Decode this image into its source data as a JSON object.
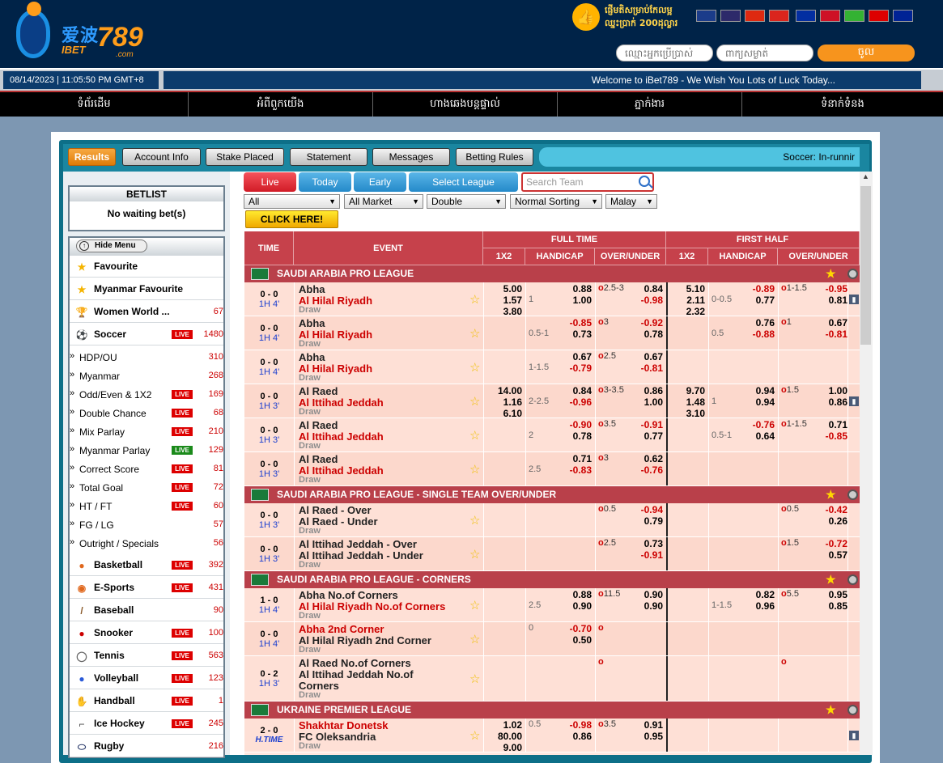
{
  "header": {
    "logo_cn": "爱波",
    "logo_num": "789",
    "logo_sub": "IBET",
    "logo_dotcom": ".com",
    "promo_line1": "ផ្ញើមតិសម្រាប់កែលម្អ",
    "promo_line2": "ឈ្នះប្រាក់ 200ដុល្លារ",
    "username_placeholder": "ឈ្មោះអ្នកប្រើប្រាស់",
    "password_placeholder": "ពាក្យសម្ងាត់",
    "login_label": "ចូល",
    "flags": [
      {
        "name": "english-flag-icon",
        "color": "#1b3c8a"
      },
      {
        "name": "thai-flag-icon",
        "color": "#2d2a6a"
      },
      {
        "name": "china-flag-icon",
        "color": "#de2910"
      },
      {
        "name": "vietnam-flag-icon",
        "color": "#da251d"
      },
      {
        "name": "cambodia-flag-icon",
        "color": "#032ea1"
      },
      {
        "name": "indonesia-flag-icon",
        "color": "#ce1126"
      },
      {
        "name": "myanmar-flag-icon",
        "color": "#34b233"
      },
      {
        "name": "germany-flag-icon",
        "color": "#dd0000"
      },
      {
        "name": "france-flag-icon",
        "color": "#002395"
      }
    ]
  },
  "status": {
    "datetime": "08/14/2023  |  11:05:50 PM GMT+8",
    "marquee": "Welcome to iBet789 - We Wish You Lots of Luck Today..."
  },
  "nav": [
    "ទំព័រដើម",
    "អំពីពួកយើង",
    "ហាងឆេងបន្តផ្ទាល់",
    "ភ្នាក់ងារ",
    "ទំនាក់ទំនង"
  ],
  "tabs": {
    "results": "Results",
    "account": "Account Info",
    "stake": "Stake Placed",
    "statement": "Statement",
    "messages": "Messages",
    "rules": "Betting Rules",
    "ticker": "Soccer: In-runnir"
  },
  "betlist": {
    "title": "BETLIST",
    "body": "No waiting bet(s)"
  },
  "menu": {
    "hide": "Hide Menu",
    "live_badge": "LIVE",
    "items": [
      {
        "label": "Favourite",
        "count": "",
        "icon": "star-icon",
        "live": false
      },
      {
        "label": "Myanmar Favourite",
        "count": "",
        "icon": "star-icon",
        "live": false
      },
      {
        "label": "Women World ...",
        "count": "67",
        "icon": "trophy-icon",
        "live": false
      },
      {
        "label": "Soccer",
        "count": "1480",
        "icon": "soccer-ball-icon",
        "live": true
      }
    ],
    "soccer_sub": [
      {
        "label": "HDP/OU",
        "count": "310",
        "live": false
      },
      {
        "label": "Myanmar",
        "count": "268",
        "live": false
      },
      {
        "label": "Odd/Even & 1X2",
        "count": "169",
        "live": true
      },
      {
        "label": "Double Chance",
        "count": "68",
        "live": true
      },
      {
        "label": "Mix Parlay",
        "count": "210",
        "live": true
      },
      {
        "label": "Myanmar Parlay",
        "count": "129",
        "live": true,
        "green": true
      },
      {
        "label": "Correct Score",
        "count": "81",
        "live": true
      },
      {
        "label": "Total Goal",
        "count": "72",
        "live": true
      },
      {
        "label": "HT / FT",
        "count": "60",
        "live": true
      },
      {
        "label": "FG / LG",
        "count": "57",
        "live": false
      },
      {
        "label": "Outright / Specials",
        "count": "56",
        "live": false
      }
    ],
    "sports": [
      {
        "label": "Basketball",
        "count": "392",
        "icon": "basketball-icon",
        "live": true
      },
      {
        "label": "E-Sports",
        "count": "431",
        "icon": "gamepad-icon",
        "live": true
      },
      {
        "label": "Baseball",
        "count": "90",
        "icon": "baseball-bat-icon",
        "live": false
      },
      {
        "label": "Snooker",
        "count": "100",
        "icon": "snooker-icon",
        "live": true
      },
      {
        "label": "Tennis",
        "count": "563",
        "icon": "tennis-racket-icon",
        "live": true
      },
      {
        "label": "Volleyball",
        "count": "123",
        "icon": "volleyball-icon",
        "live": true
      },
      {
        "label": "Handball",
        "count": "1",
        "icon": "handball-icon",
        "live": true
      },
      {
        "label": "Ice Hockey",
        "count": "245",
        "icon": "ice-hockey-icon",
        "live": true
      },
      {
        "label": "Rugby",
        "count": "216",
        "icon": "rugby-ball-icon",
        "live": false
      }
    ]
  },
  "filters": {
    "live": "Live",
    "today": "Today",
    "early": "Early",
    "select_league": "Select League",
    "search_placeholder": "Search Team",
    "dd_all": "All",
    "dd_market": "All Market",
    "dd_double": "Double",
    "dd_sorting": "Normal Sorting",
    "dd_malay": "Malay",
    "click_here": "CLICK HERE!"
  },
  "table_head": {
    "time": "TIME",
    "event": "EVENT",
    "full_time": "FULL TIME",
    "first_half": "FIRST HALF",
    "x12": "1X2",
    "handicap": "HANDICAP",
    "ou": "OVER/UNDER"
  },
  "leagues": [
    {
      "name": "SAUDI ARABIA PRO LEAGUE",
      "matches": [
        {
          "score": "0 - 0",
          "time": "1H 4'",
          "home": "Abha",
          "away": "Al Hilal Riyadh",
          "draw": "Draw",
          "red": "away",
          "x12": [
            "5.00",
            "1.57",
            "3.80"
          ],
          "hdp": "1",
          "hdp_row": 2,
          "hdp_odds": [
            "0.88",
            "1.00"
          ],
          "ou": "2.5-3",
          "ou_odds": [
            "0.84",
            "-0.98"
          ],
          "h_x12": [
            "5.10",
            "2.11",
            "2.32"
          ],
          "h_hdp": "0-0.5",
          "h_hdp_row": 2,
          "h_hdp_odds": [
            "-0.89",
            "0.77"
          ],
          "h_ou": "1-1.5",
          "h_ou_odds": [
            "-0.95",
            "0.81"
          ],
          "chart": true
        },
        {
          "score": "0 - 0",
          "time": "1H 4'",
          "home": "Abha",
          "away": "Al Hilal Riyadh",
          "draw": "Draw",
          "red": "away",
          "x12": [],
          "hdp": "0.5-1",
          "hdp_row": 2,
          "hdp_odds": [
            "-0.85",
            "0.73"
          ],
          "ou": "3",
          "ou_odds": [
            "-0.92",
            "0.78"
          ],
          "h_x12": [],
          "h_hdp": "0.5",
          "h_hdp_row": 2,
          "h_hdp_odds": [
            "0.76",
            "-0.88"
          ],
          "h_ou": "1",
          "h_ou_odds": [
            "0.67",
            "-0.81"
          ],
          "chart": false
        },
        {
          "score": "0 - 0",
          "time": "1H 4'",
          "home": "Abha",
          "away": "Al Hilal Riyadh",
          "draw": "Draw",
          "red": "away",
          "x12": [],
          "hdp": "1-1.5",
          "hdp_row": 2,
          "hdp_odds": [
            "0.67",
            "-0.79"
          ],
          "ou": "2.5",
          "ou_odds": [
            "0.67",
            "-0.81"
          ],
          "h_x12": [],
          "h_hdp": "",
          "h_hdp_row": 2,
          "h_hdp_odds": [
            "",
            ""
          ],
          "h_ou": "",
          "h_ou_odds": [
            "",
            ""
          ],
          "chart": false
        },
        {
          "score": "0 - 0",
          "time": "1H 3'",
          "home": "Al Raed",
          "away": "Al Ittihad Jeddah",
          "draw": "Draw",
          "red": "away",
          "x12": [
            "14.00",
            "1.16",
            "6.10"
          ],
          "hdp": "2-2.5",
          "hdp_row": 2,
          "hdp_odds": [
            "0.84",
            "-0.96"
          ],
          "ou": "3-3.5",
          "ou_odds": [
            "0.86",
            "1.00"
          ],
          "h_x12": [
            "9.70",
            "1.48",
            "3.10"
          ],
          "h_hdp": "1",
          "h_hdp_row": 2,
          "h_hdp_odds": [
            "0.94",
            "0.94"
          ],
          "h_ou": "1.5",
          "h_ou_odds": [
            "1.00",
            "0.86"
          ],
          "chart": true
        },
        {
          "score": "0 - 0",
          "time": "1H 3'",
          "home": "Al Raed",
          "away": "Al Ittihad Jeddah",
          "draw": "Draw",
          "red": "away",
          "x12": [],
          "hdp": "2",
          "hdp_row": 2,
          "hdp_odds": [
            "-0.90",
            "0.78"
          ],
          "ou": "3.5",
          "ou_odds": [
            "-0.91",
            "0.77"
          ],
          "h_x12": [],
          "h_hdp": "0.5-1",
          "h_hdp_row": 2,
          "h_hdp_odds": [
            "-0.76",
            "0.64"
          ],
          "h_ou": "1-1.5",
          "h_ou_odds": [
            "0.71",
            "-0.85"
          ],
          "chart": false
        },
        {
          "score": "0 - 0",
          "time": "1H 3'",
          "home": "Al Raed",
          "away": "Al Ittihad Jeddah",
          "draw": "Draw",
          "red": "away",
          "x12": [],
          "hdp": "2.5",
          "hdp_row": 2,
          "hdp_odds": [
            "0.71",
            "-0.83"
          ],
          "ou": "3",
          "ou_odds": [
            "0.62",
            "-0.76"
          ],
          "h_x12": [],
          "h_hdp": "",
          "h_hdp_row": 2,
          "h_hdp_odds": [
            "",
            ""
          ],
          "h_ou": "",
          "h_ou_odds": [
            "",
            ""
          ],
          "chart": false
        }
      ]
    },
    {
      "name": "SAUDI ARABIA PRO LEAGUE - SINGLE TEAM OVER/UNDER",
      "matches": [
        {
          "score": "0 - 0",
          "time": "1H 3'",
          "home": "Al Raed - Over",
          "away": "Al Raed - Under",
          "draw": "Draw",
          "red": "none",
          "x12": [],
          "hdp": "",
          "hdp_row": 1,
          "hdp_odds": [
            "",
            ""
          ],
          "ou": "0.5",
          "ou_odds": [
            "-0.94",
            "0.79"
          ],
          "h_x12": [],
          "h_hdp": "",
          "h_hdp_row": 1,
          "h_hdp_odds": [
            "",
            ""
          ],
          "h_ou": "0.5",
          "h_ou_odds": [
            "-0.42",
            "0.26"
          ],
          "chart": false
        },
        {
          "score": "0 - 0",
          "time": "1H 3'",
          "home": "Al Ittihad Jeddah - Over",
          "away": "Al Ittihad Jeddah - Under",
          "draw": "Draw",
          "red": "none",
          "x12": [],
          "hdp": "",
          "hdp_row": 1,
          "hdp_odds": [
            "",
            ""
          ],
          "ou": "2.5",
          "ou_odds": [
            "0.73",
            "-0.91"
          ],
          "h_x12": [],
          "h_hdp": "",
          "h_hdp_row": 1,
          "h_hdp_odds": [
            "",
            ""
          ],
          "h_ou": "1.5",
          "h_ou_odds": [
            "-0.72",
            "0.57"
          ],
          "chart": false
        }
      ]
    },
    {
      "name": "SAUDI ARABIA PRO LEAGUE - CORNERS",
      "matches": [
        {
          "score": "1 - 0",
          "time": "1H 4'",
          "home": "Abha No.of Corners",
          "away": "Al Hilal Riyadh No.of Corners",
          "draw": "Draw",
          "red": "away",
          "x12": [],
          "hdp": "2.5",
          "hdp_row": 2,
          "hdp_odds": [
            "0.88",
            "0.90"
          ],
          "ou": "11.5",
          "ou_odds": [
            "0.90",
            "0.90"
          ],
          "h_x12": [],
          "h_hdp": "1-1.5",
          "h_hdp_row": 2,
          "h_hdp_odds": [
            "0.82",
            "0.96"
          ],
          "h_ou": "5.5",
          "h_ou_odds": [
            "0.95",
            "0.85"
          ],
          "chart": false
        },
        {
          "score": "0 - 0",
          "time": "1H 4'",
          "home": "Abha 2nd Corner",
          "away": "Al Hilal Riyadh 2nd Corner",
          "draw": "Draw",
          "red": "home",
          "x12": [],
          "hdp": "0",
          "hdp_row": 1,
          "hdp_odds": [
            "-0.70",
            "0.50"
          ],
          "ou": "",
          "ou_odds": [
            "",
            ""
          ],
          "h_x12": [],
          "h_hdp": "",
          "h_hdp_row": 1,
          "h_hdp_odds": [
            "",
            ""
          ],
          "h_ou": "",
          "h_ou_odds": [
            "",
            ""
          ],
          "chart": false
        },
        {
          "score": "0 - 2",
          "time": "1H 3'",
          "home": "Al Raed No.of Corners",
          "away": "Al Ittihad Jeddah No.of",
          "away2": "Corners",
          "draw": "Draw",
          "red": "none",
          "x12": [],
          "hdp": "",
          "hdp_row": 1,
          "hdp_odds": [
            "",
            ""
          ],
          "ou": "",
          "ou_odds": [
            "",
            ""
          ],
          "h_x12": [],
          "h_hdp": "",
          "h_hdp_row": 1,
          "h_hdp_odds": [
            "",
            ""
          ],
          "h_ou": "",
          "h_ou_odds": [
            "",
            ""
          ],
          "chart": false
        }
      ]
    },
    {
      "name": "UKRAINE PREMIER LEAGUE",
      "matches": [
        {
          "score": "2 - 0",
          "time": "H.TIME",
          "home": "Shakhtar Donetsk",
          "away": "FC Oleksandria",
          "draw": "Draw",
          "red": "home",
          "x12": [
            "1.02",
            "80.00",
            "9.00"
          ],
          "hdp": "0.5",
          "hdp_row": 1,
          "hdp_odds": [
            "-0.98",
            "0.86"
          ],
          "ou": "3.5",
          "ou_odds": [
            "0.91",
            "0.95"
          ],
          "h_x12": [],
          "h_hdp": "",
          "h_hdp_row": 1,
          "h_hdp_odds": [
            "",
            ""
          ],
          "h_ou": "",
          "h_ou_odds": [
            "",
            ""
          ],
          "chart": true
        }
      ]
    }
  ]
}
